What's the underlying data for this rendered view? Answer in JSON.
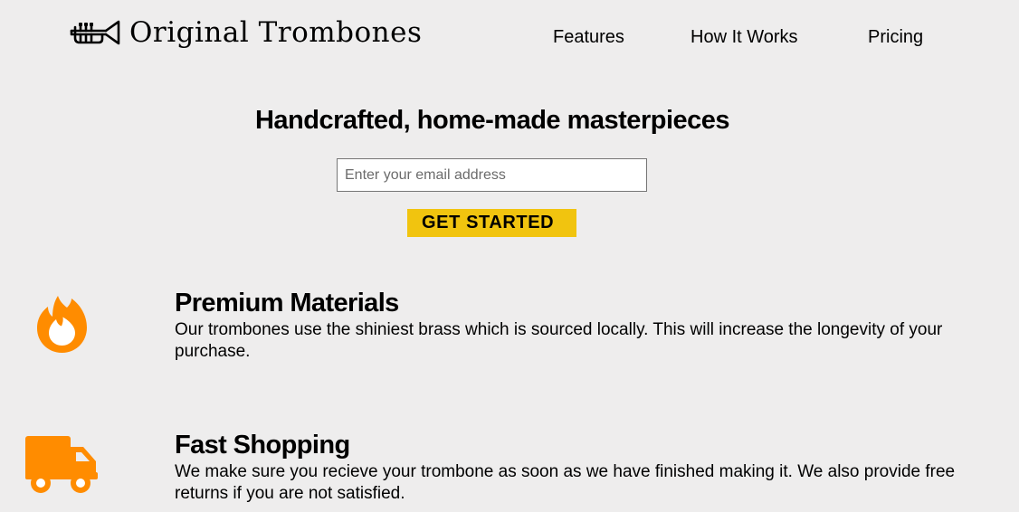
{
  "header": {
    "brand": "Original Trombones",
    "logo_icon": "trombone-icon",
    "nav": [
      {
        "label": "Features"
      },
      {
        "label": "How It Works"
      },
      {
        "label": "Pricing"
      }
    ]
  },
  "hero": {
    "title": "Handcrafted, home-made masterpieces",
    "email_placeholder": "Enter your email address",
    "email_value": "",
    "cta_label": "GET STARTED",
    "cta_color": "#f1c40f"
  },
  "features": [
    {
      "icon": "fire-icon",
      "title": "Premium Materials",
      "text": "Our trombones use the shiniest brass which is sourced locally. This will increase the longevity of your purchase."
    },
    {
      "icon": "truck-icon",
      "title": "Fast Shopping",
      "text": "We make sure you recieve your trombone as soon as we have finished making it. We also provide free returns if you are not satisfied."
    }
  ],
  "colors": {
    "background": "#eeeded",
    "accent_icon": "#ff8c00"
  }
}
